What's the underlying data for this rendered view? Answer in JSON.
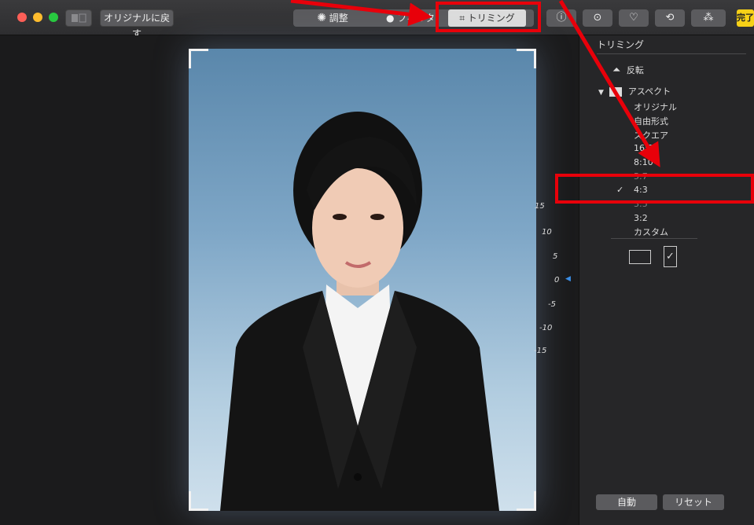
{
  "toolbar": {
    "revert_label": "オリジナルに戻す",
    "tabs": [
      {
        "label": "調整",
        "icon": "adjust-icon"
      },
      {
        "label": "フィルタ",
        "icon": "filter-icon"
      },
      {
        "label": "トリミング",
        "icon": "crop-icon"
      }
    ],
    "active_tab": "トリミング",
    "done_label": "完了"
  },
  "dial": {
    "ticks": [
      "15",
      "10",
      "5",
      "0",
      "-5",
      "-10",
      "-15"
    ]
  },
  "sidebar": {
    "title": "トリミング",
    "flip_label": "反転",
    "aspect_label": "アスペクト",
    "aspect_options": [
      "オリジナル",
      "自由形式",
      "スクエア",
      "16:9",
      "8:10",
      "5:7",
      "4:3",
      "3:5",
      "3:2",
      "カスタム"
    ],
    "selected_option": "4:3",
    "checkmark": "✓",
    "auto_label": "自動",
    "reset_label": "リセット"
  },
  "colors": {
    "highlight": "#e8000a",
    "done_button": "#f7d117",
    "dial_accent": "#3a8ee6"
  }
}
